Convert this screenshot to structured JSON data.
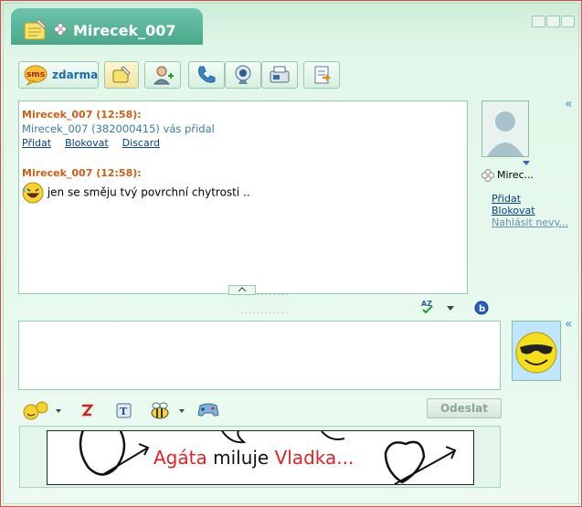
{
  "window": {
    "title": "Mirecek_007"
  },
  "toolbar": {
    "sms_label": "zdarma",
    "sms_badge": "sms"
  },
  "chat": {
    "messages": [
      {
        "sender": "Mirecek_007 (12:58):",
        "text": "Mirecek_007 (382000415) vás přidal",
        "links": [
          "Přidat",
          "Blokovat",
          "Discard"
        ]
      },
      {
        "sender": "Mirecek_007 (12:58):",
        "text": "jen se směju tvý povrchní chytrosti  .."
      }
    ]
  },
  "contact": {
    "name": "Mirec...",
    "links": [
      "Přidat",
      "Blokovat",
      "Nahlásit nevy..."
    ]
  },
  "compose": {
    "send_label": "Odeslat"
  },
  "banner": {
    "part1": "Agáta",
    "part2": "miluje",
    "part3": "Vladka..."
  },
  "colors": {
    "sender": "#d25c11",
    "link": "#0b3f8a",
    "accent": "#4aa889"
  }
}
